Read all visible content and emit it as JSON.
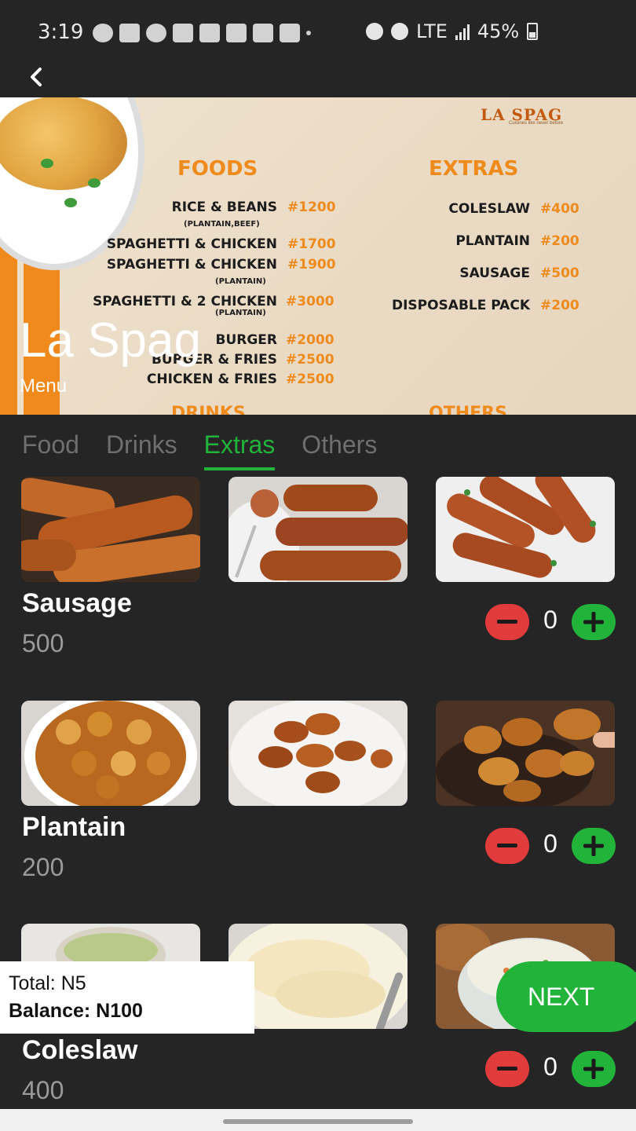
{
  "status_bar": {
    "time": "3:19",
    "network": "LTE",
    "battery": "45%"
  },
  "header": {
    "back_icon": "chevron-left-icon"
  },
  "hero": {
    "restaurant_name": "La Spag",
    "subtitle": "Menu",
    "logo_text": "LA SPAG",
    "logo_tagline": "Cuisines like never before",
    "board": {
      "foods_heading": "FOODS",
      "extras_heading": "EXTRAS",
      "drinks_heading": "DRINKS",
      "others_heading": "OTHERS",
      "foods": [
        {
          "name": "RICE & BEANS",
          "price": "#1200",
          "note": "(PLANTAIN,BEEF)"
        },
        {
          "name": "SPAGHETTI & CHICKEN",
          "price": "#1700",
          "note": ""
        },
        {
          "name": "SPAGHETTI & CHICKEN",
          "price": "#1900",
          "note": "(PLANTAIN)"
        },
        {
          "name": "SPAGHETTI & 2 CHICKEN",
          "price": "#3000",
          "note": "(PLANTAIN)"
        },
        {
          "name": "BURGER",
          "price": "#2000",
          "note": ""
        },
        {
          "name": "BURGER & FRIES",
          "price": "#2500",
          "note": ""
        },
        {
          "name": "CHICKEN & FRIES",
          "price": "#2500",
          "note": ""
        }
      ],
      "extras": [
        {
          "name": "COLESLAW",
          "price": "#400"
        },
        {
          "name": "PLANTAIN",
          "price": "#200"
        },
        {
          "name": "SAUSAGE",
          "price": "#500"
        },
        {
          "name": "DISPOSABLE PACK",
          "price": "#200"
        }
      ]
    }
  },
  "tabs": [
    {
      "label": "Food",
      "active": false
    },
    {
      "label": "Drinks",
      "active": false
    },
    {
      "label": "Extras",
      "active": true
    },
    {
      "label": "Others",
      "active": false
    }
  ],
  "items": [
    {
      "name": "Sausage",
      "price": "500",
      "quantity": "0"
    },
    {
      "name": "Plantain",
      "price": "200",
      "quantity": "0"
    },
    {
      "name": "Coleslaw",
      "price": "400",
      "quantity": "0"
    }
  ],
  "footer": {
    "total": "Total: N5",
    "balance": "Balance: N100",
    "next_label": "NEXT"
  },
  "colors": {
    "accent_green": "#22b33b",
    "minus_red": "#e23b3b",
    "background": "#252525",
    "board_orange": "#ef8a1d"
  }
}
